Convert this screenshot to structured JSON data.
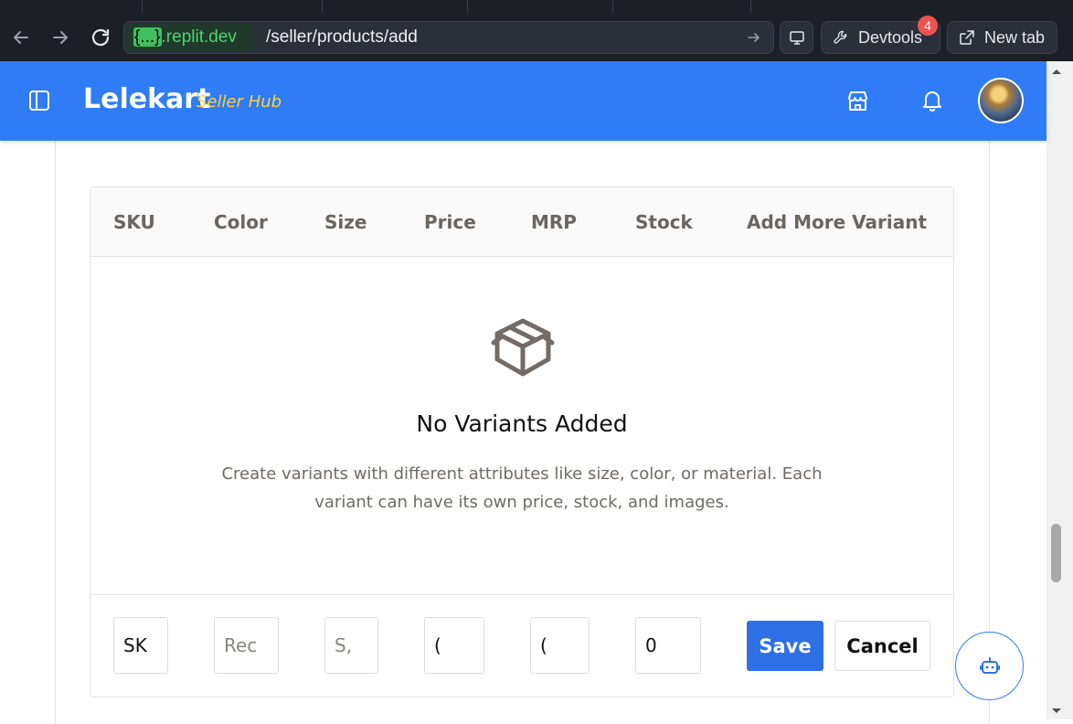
{
  "browser": {
    "url_host_brace": "{...}",
    "url_host": ".replit.dev",
    "url_path": "/seller/products/add",
    "devtools_label": "Devtools",
    "devtools_badge": "4",
    "new_tab_label": "New tab"
  },
  "header": {
    "brand": "Lelekart",
    "brand_sub": "Seller Hub",
    "accent_color": "#2f7cf6",
    "sub_color": "#ffd23f"
  },
  "variants_table": {
    "columns": [
      "SKU",
      "Color",
      "Size",
      "Price",
      "MRP",
      "Stock",
      "Add More Variant"
    ],
    "empty_title": "No Variants Added",
    "empty_description": "Create variants with different attributes like size, color, or material. Each variant can have its own price, stock, and images.",
    "row_inputs": {
      "sku": {
        "value": "SK",
        "placeholder": ""
      },
      "color": {
        "value": "",
        "placeholder": "Rec"
      },
      "size": {
        "value": "",
        "placeholder": "S,"
      },
      "price": {
        "value": "(",
        "placeholder": ""
      },
      "mrp": {
        "value": "(",
        "placeholder": ""
      },
      "stock": {
        "value": "0",
        "placeholder": ""
      }
    },
    "save_label": "Save",
    "cancel_label": "Cancel"
  }
}
